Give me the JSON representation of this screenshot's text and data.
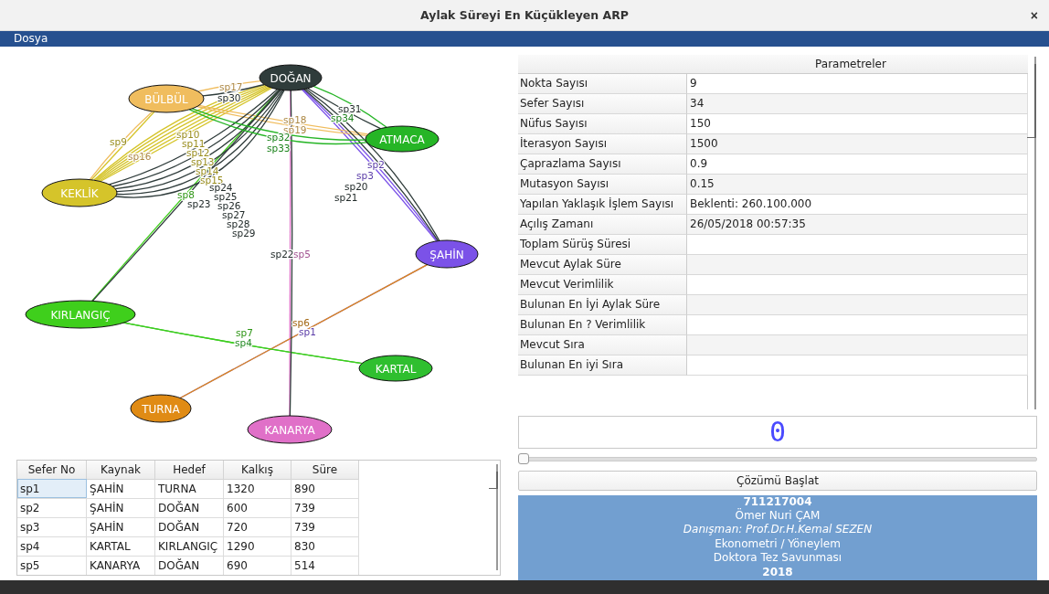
{
  "window": {
    "title": "Aylak Süreyi En Küçükleyen ARP",
    "close_glyph": "×"
  },
  "menu": [
    "Dosya"
  ],
  "graph": {
    "nodes": [
      {
        "label": "DOĞAN",
        "color": "#2f3c3b"
      },
      {
        "label": "BÜLBÜL",
        "color": "#f0bd5e"
      },
      {
        "label": "ATMACA",
        "color": "#26b526"
      },
      {
        "label": "KEKLİK",
        "color": "#d5c42a"
      },
      {
        "label": "ŞAHİN",
        "color": "#7b52e8"
      },
      {
        "label": "KIRLANGIÇ",
        "color": "#3fcf1c"
      },
      {
        "label": "KARTAL",
        "color": "#2fbf2f"
      },
      {
        "label": "TURNA",
        "color": "#e08b14"
      },
      {
        "label": "KANARYA",
        "color": "#e070c8"
      }
    ],
    "edges": [
      {
        "label": "sp1"
      },
      {
        "label": "sp2"
      },
      {
        "label": "sp3"
      },
      {
        "label": "sp4"
      },
      {
        "label": "sp5"
      },
      {
        "label": "sp6"
      },
      {
        "label": "sp7"
      },
      {
        "label": "sp8"
      },
      {
        "label": "sp9"
      },
      {
        "label": "sp10"
      },
      {
        "label": "sp11"
      },
      {
        "label": "sp12"
      },
      {
        "label": "sp13"
      },
      {
        "label": "sp14"
      },
      {
        "label": "sp15"
      },
      {
        "label": "sp16"
      },
      {
        "label": "sp17"
      },
      {
        "label": "sp18"
      },
      {
        "label": "sp19"
      },
      {
        "label": "sp20"
      },
      {
        "label": "sp21"
      },
      {
        "label": "sp22"
      },
      {
        "label": "sp23"
      },
      {
        "label": "sp24"
      },
      {
        "label": "sp25"
      },
      {
        "label": "sp26"
      },
      {
        "label": "sp27"
      },
      {
        "label": "sp28"
      },
      {
        "label": "sp29"
      },
      {
        "label": "sp30"
      },
      {
        "label": "sp31"
      },
      {
        "label": "sp32"
      },
      {
        "label": "sp33"
      },
      {
        "label": "sp34"
      }
    ]
  },
  "trips": {
    "columns": [
      "Sefer No",
      "Kaynak",
      "Hedef",
      "Kalkış",
      "Süre"
    ],
    "rows": [
      {
        "cells": [
          "sp1",
          "ŞAHİN",
          "TURNA",
          "1320",
          "890"
        ],
        "selected": true
      },
      {
        "cells": [
          "sp2",
          "ŞAHİN",
          "DOĞAN",
          "600",
          "739"
        ],
        "selected": false
      },
      {
        "cells": [
          "sp3",
          "ŞAHİN",
          "DOĞAN",
          "720",
          "739"
        ],
        "selected": false
      },
      {
        "cells": [
          "sp4",
          "KARTAL",
          "KIRLANGIÇ",
          "1290",
          "830"
        ],
        "selected": false
      },
      {
        "cells": [
          "sp5",
          "KANARYA",
          "DOĞAN",
          "690",
          "514"
        ],
        "selected": false
      }
    ]
  },
  "parameters": {
    "header": "Parametreler",
    "rows": [
      {
        "name": "Nokta Sayısı",
        "value": "9"
      },
      {
        "name": "Sefer Sayısı",
        "value": "34"
      },
      {
        "name": "Nüfus Sayısı",
        "value": "150"
      },
      {
        "name": "İterasyon Sayısı",
        "value": "1500"
      },
      {
        "name": "Çaprazlama Sayısı",
        "value": "0.9"
      },
      {
        "name": "Mutasyon Sayısı",
        "value": "0.15"
      },
      {
        "name": "Yapılan Yaklaşık İşlem Sayısı",
        "value": "Beklenti: 260.100.000"
      },
      {
        "name": "Açılış Zamanı",
        "value": "26/05/2018 00:57:35"
      },
      {
        "name": "Toplam Sürüş Süresi"
      },
      {
        "name": "Mevcut Aylak Süre"
      },
      {
        "name": "Mevcut Verimlilik"
      },
      {
        "name": "Bulunan En İyi Aylak Süre"
      },
      {
        "name": "Bulunan En ? Verimlilik"
      },
      {
        "name": "Mevcut Sıra"
      },
      {
        "name": "Bulunan En iyi Sıra"
      }
    ]
  },
  "counter": "0",
  "progress": {
    "level": 0
  },
  "start_button": "Çözümü Başlat",
  "info": [
    {
      "text": "711217004",
      "kind": "bold"
    },
    {
      "text": "Ömer Nuri ÇAM",
      "kind": "plain"
    },
    {
      "text": "Danışman: Prof.Dr.H.Kemal SEZEN",
      "kind": "italic"
    },
    {
      "text": "Ekonometri / Yöneylem",
      "kind": "plain"
    },
    {
      "text": "Doktora Tez Savunması",
      "kind": "plain"
    },
    {
      "text": "2018",
      "kind": "bold"
    }
  ]
}
